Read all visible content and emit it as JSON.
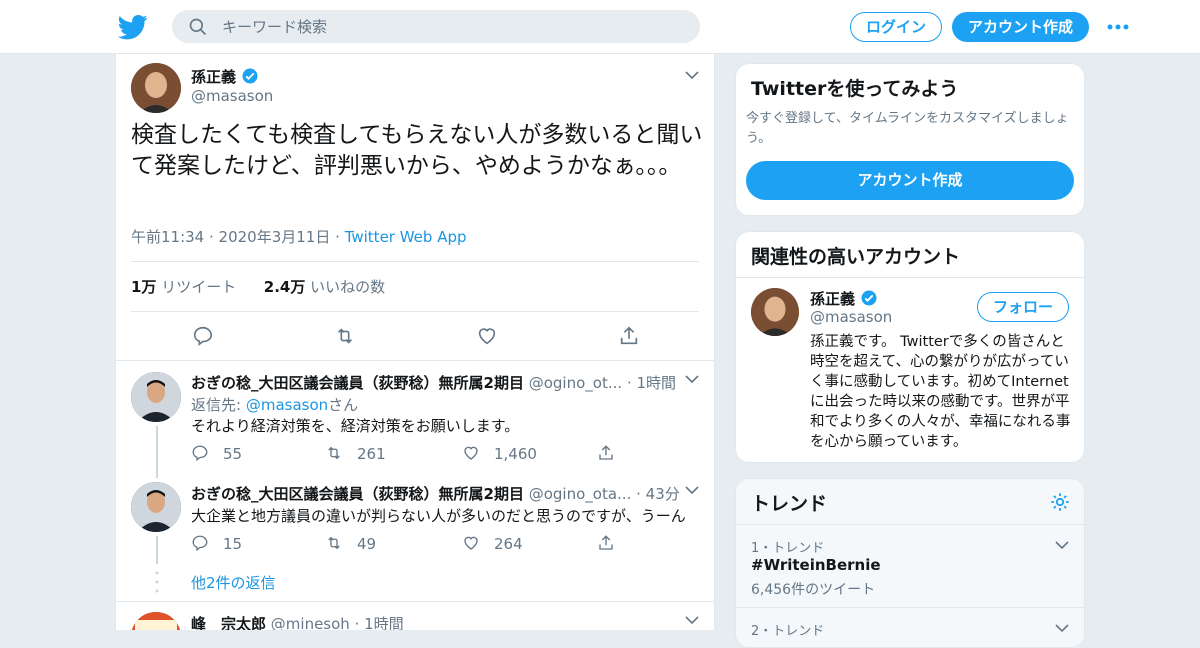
{
  "header": {
    "search_placeholder": "キーワード検索",
    "login_label": "ログイン",
    "signup_label": "アカウント作成"
  },
  "tweet": {
    "author_name": "孫正義",
    "author_handle": "@masason",
    "text": "検査したくても検査してもらえない人が多数いると聞いて発案したけど、評判悪いから、やめようかなぁ。。。",
    "time": "午前11:34 · 2020年3月11日",
    "separator": "·",
    "source": "Twitter Web App",
    "retweets_count": "1万",
    "retweets_label": "リツイート",
    "likes_count": "2.4万",
    "likes_label": "いいねの数"
  },
  "replies": [
    {
      "author_name": "おぎの稔_大田区議会議員（荻野稔）無所属2期目",
      "author_handle": "@ogino_ot...",
      "time": "· 1時間",
      "reply_to_prefix": "返信先: ",
      "reply_to_handle": "@masason",
      "reply_to_suffix": "さん",
      "text": "それより経済対策を、経済対策をお願いします。",
      "reply_count": "55",
      "retweet_count": "261",
      "like_count": "1,460"
    },
    {
      "author_name": "おぎの稔_大田区議会議員（荻野稔）無所属2期目",
      "author_handle": "@ogino_ota...",
      "time": "· 43分",
      "text": "大企業と地方議員の違いが判らない人が多いのだと思うのですが、うーん",
      "reply_count": "15",
      "retweet_count": "49",
      "like_count": "264"
    }
  ],
  "more_replies_label": "他2件の返信",
  "third_reply": {
    "author_name": "峰　宗太郎",
    "author_handle": "@minesoh",
    "time": "· 1時間"
  },
  "signup_card": {
    "title": "Twitterを使ってみよう",
    "description": "今すぐ登録して、タイムラインをカスタマイズしましょう。",
    "button_label": "アカウント作成"
  },
  "relevant_card": {
    "title": "関連性の高いアカウント",
    "name": "孫正義",
    "handle": "@masason",
    "follow_label": "フォロー",
    "bio": "孫正義です。 Twitterで多くの皆さんと時空を超えて、心の繋がりが広がっていく事に感動しています。初めてInternetに出会った時以来の感動です。世界が平和でより多くの人々が、幸福になれる事を心から願っています。"
  },
  "trends": {
    "title": "トレンド",
    "items": [
      {
        "rank_label": "1・トレンド",
        "name": "#WriteinBernie",
        "count": "6,456件のツイート"
      },
      {
        "rank_label": "2・トレンド"
      }
    ]
  },
  "colors": {
    "brand": "#1da1f2",
    "link": "#1b95e0",
    "muted": "#657786",
    "background": "#e6ecf0"
  }
}
